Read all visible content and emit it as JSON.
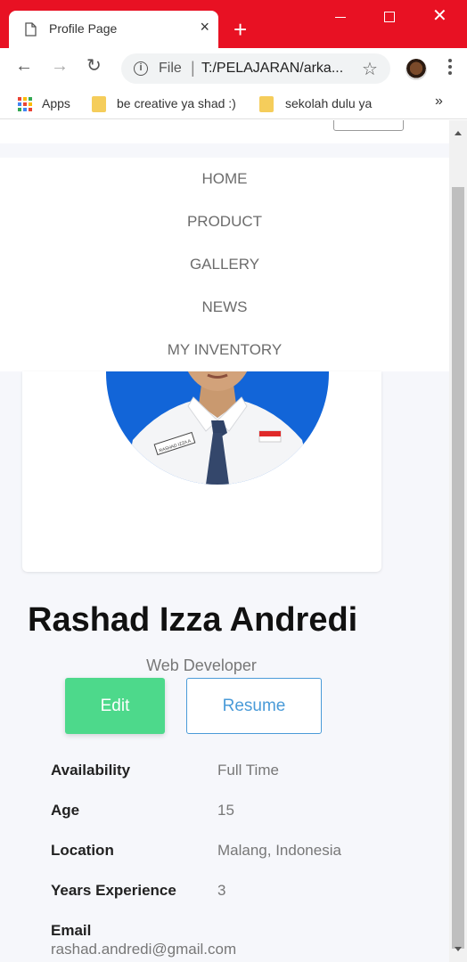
{
  "browser": {
    "tab_title": "Profile Page",
    "tab_close": "×",
    "new_tab": "+",
    "window_close": "✕",
    "address": {
      "scheme": "File",
      "separator": "|",
      "url": "T:/PELAJARAN/arka..."
    },
    "nav": {
      "back": "←",
      "forward": "→",
      "reload": "↻",
      "star": "☆"
    },
    "bookmarks": [
      {
        "label": "Apps",
        "icon": "apps-grid-icon"
      },
      {
        "label": "be creative ya shad :)",
        "icon": "folder-icon"
      },
      {
        "label": "sekolah dulu ya",
        "icon": "folder-icon"
      }
    ],
    "bookmarks_overflow": "»"
  },
  "page": {
    "nav_items": [
      "HOME",
      "PRODUCT",
      "GALLERY",
      "NEWS",
      "MY INVENTORY"
    ],
    "profile": {
      "name": "Rashad Izza Andredi",
      "role": "Web Developer",
      "badge_text": "RASHAD IZZA A",
      "photo_bg": "#1265d8"
    },
    "buttons": {
      "edit": "Edit",
      "resume": "Resume"
    },
    "details": [
      {
        "label": "Availability",
        "value": "Full Time"
      },
      {
        "label": "Age",
        "value": "15"
      },
      {
        "label": "Location",
        "value": "Malang, Indonesia"
      },
      {
        "label": "Years Experience",
        "value": "3"
      }
    ],
    "email": {
      "label": "Email",
      "value": "rashad.andredi@gmail.com"
    }
  },
  "colors": {
    "titlebar": "#e81123",
    "edit_button": "#4dd98b",
    "resume_border": "#4a9bd8",
    "page_bg": "#f6f7fb"
  }
}
